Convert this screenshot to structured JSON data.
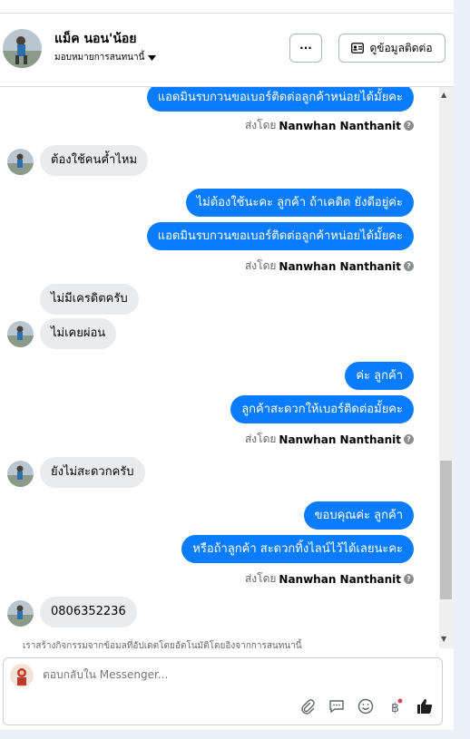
{
  "header": {
    "name": "แม็ค นอน'น้อย",
    "subtitle": "มอบหมายการสนทนานี้",
    "more_label": "···",
    "contact_label": "ดูข้อมูลติดต่อ"
  },
  "messages": {
    "m1": "แอดมินรบกวนขอเบอร์ติดต่อลูกค้าหน่อยได้มั้ยคะ",
    "m2": "ต้องใช้คนค้ำไหม",
    "m3": "ไม่ต้องใช้นะคะ ลูกค้า ถ้าเคดิต ยังดีอยู่ค่ะ",
    "m4": "แอดมินรบกวนขอเบอร์ติดต่อลูกค้าหน่อยได้มั้ยคะ",
    "m5": "ไม่มีเครดิตครับ",
    "m6": "ไม่เคยผ่อน",
    "m7": "ค่ะ ลูกค้า",
    "m8": "ลูกค้าสะดวกให้เบอร์ติดต่อมั้ยคะ",
    "m9": "ยังไม่สะดวกครับ",
    "m10": "ขอบคุณค่ะ ลูกค้า",
    "m11": "หรือถ้าลูกค้า สะดวกทิ้งไลน์ไว้ได้เลยนะคะ",
    "m12": "0806352236"
  },
  "sent_by": {
    "prefix": "ส่งโดย",
    "name": "Nanwhan Nanthanit"
  },
  "notice": "เราสร้างกิจกรรมจากข้อมูลที่อัปเดตโดยอัตโนมัติโดยอิงจากการสนทนานี้",
  "composer": {
    "placeholder": "ตอบกลับใน Messenger..."
  },
  "icons": {
    "more": "more-icon",
    "contact": "contact-card-icon",
    "attach": "paperclip-icon",
    "saved_reply": "chat-bubble-icon",
    "emoji": "smiley-icon",
    "payment": "baht-icon",
    "like": "thumbs-up-icon"
  },
  "colors": {
    "outgoing_bubble": "#0a7cff",
    "incoming_bubble": "#e9ebee",
    "accent": "#0a7cff"
  }
}
